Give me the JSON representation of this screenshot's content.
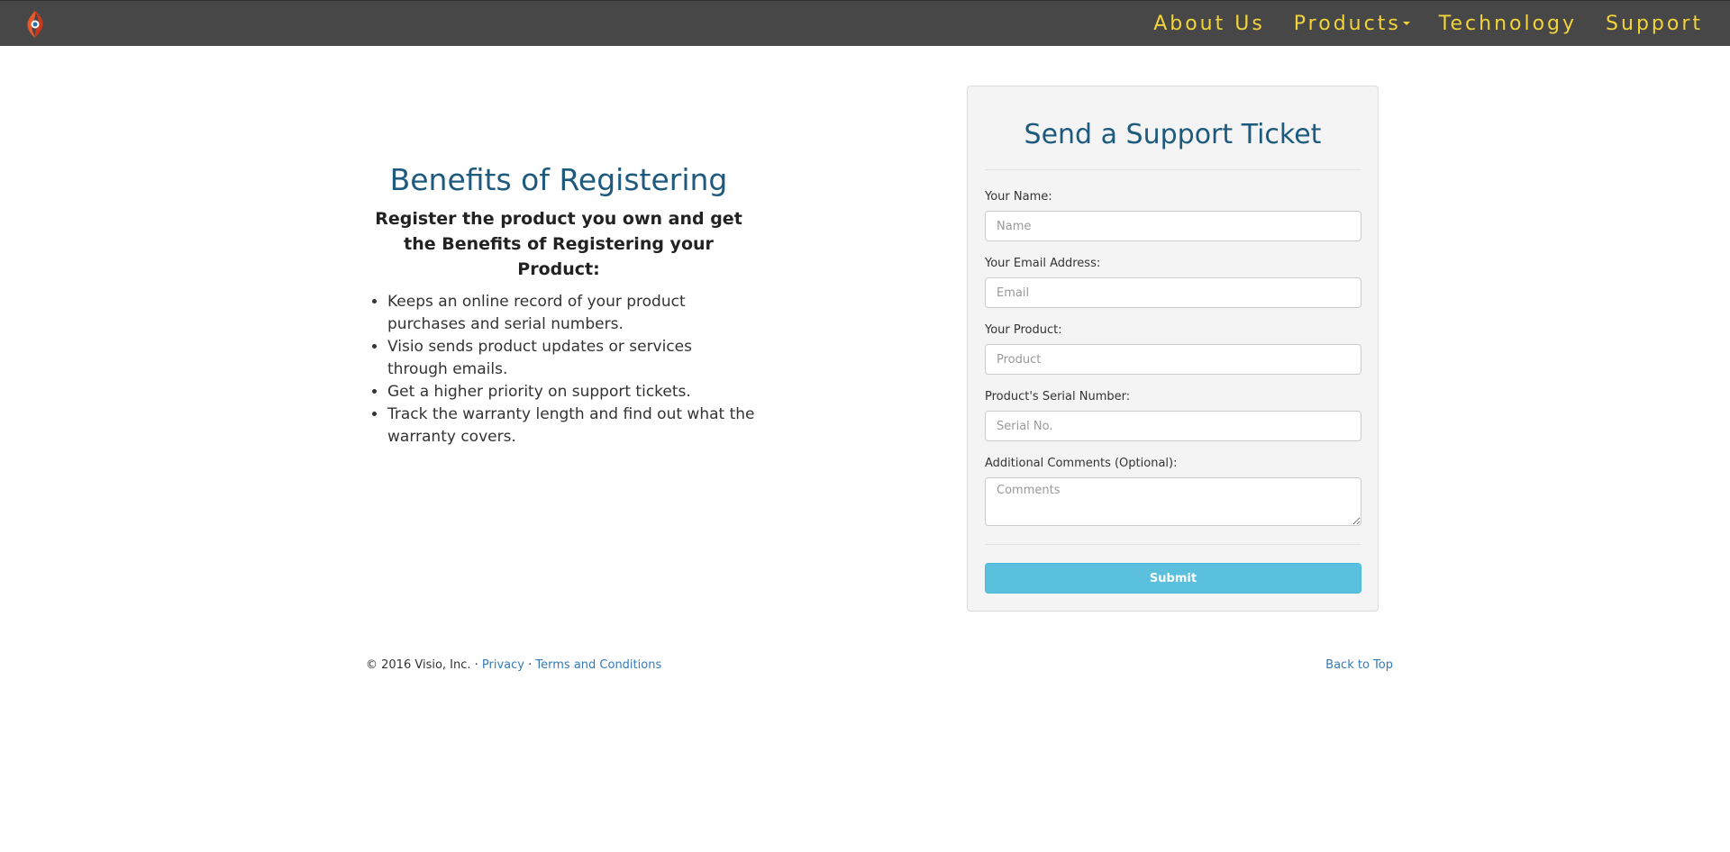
{
  "nav": {
    "items": [
      {
        "label": "About Us"
      },
      {
        "label": "Products"
      },
      {
        "label": "Technology"
      },
      {
        "label": "Support"
      }
    ]
  },
  "benefits": {
    "title": "Benefits of Registering",
    "subtitle": "Register the product you own and get the Benefits of Registering your Product:",
    "items": [
      "Keeps an online record of your product purchases and serial numbers.",
      "Visio sends product updates or services through emails.",
      "Get a higher priority on support tickets.",
      "Track the warranty length and find out what the warranty covers."
    ]
  },
  "form": {
    "title": "Send a Support Ticket",
    "fields": [
      {
        "label": "Your Name:",
        "placeholder": "Name",
        "value": ""
      },
      {
        "label": "Your Email Address:",
        "placeholder": "Email",
        "value": ""
      },
      {
        "label": "Your Product:",
        "placeholder": "Product",
        "value": ""
      },
      {
        "label": "Product's Serial Number:",
        "placeholder": "Serial No.",
        "value": ""
      },
      {
        "label": "Additional Comments (Optional):",
        "placeholder": "Comments",
        "value": ""
      }
    ],
    "submit_label": "Submit"
  },
  "footer": {
    "copyright": "© 2016 Visio, Inc. · ",
    "privacy": "Privacy",
    "separator": " · ",
    "terms": "Terms and Conditions",
    "back_to_top": "Back to Top"
  },
  "colors": {
    "navbar": "#474747",
    "nav_text": "#f2d43a",
    "heading": "#1d5a7e",
    "submit": "#5bc0de",
    "link": "#337ab7"
  }
}
